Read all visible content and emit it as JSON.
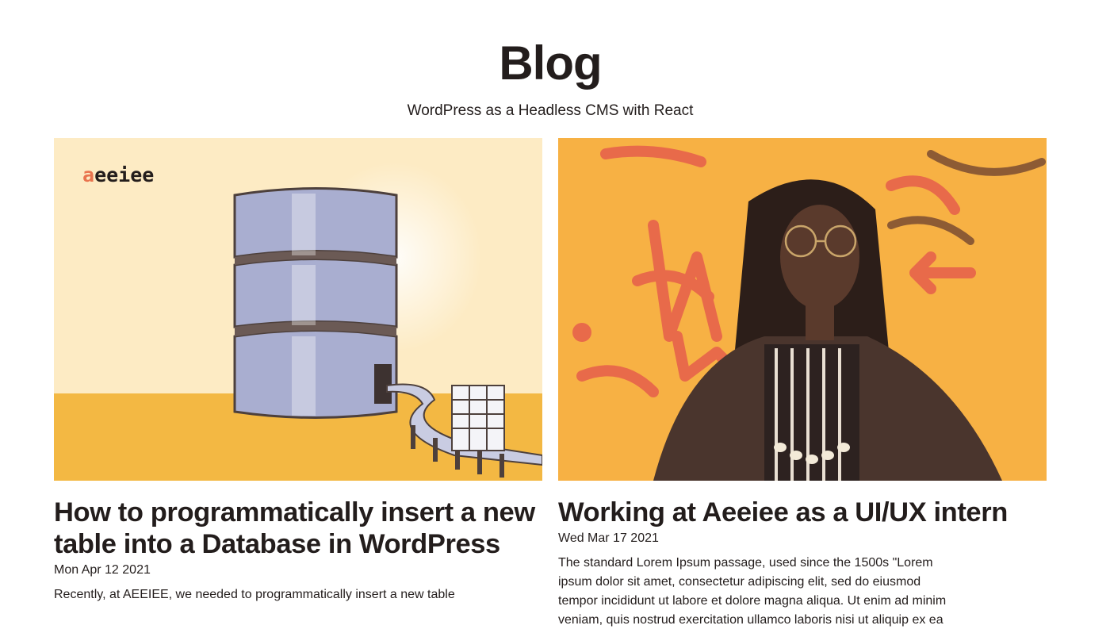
{
  "header": {
    "title": "Blog",
    "subtitle": "WordPress as a Headless CMS with React"
  },
  "posts": [
    {
      "image": {
        "logo_text": "aeeiee",
        "logo_accent": "#e9744e",
        "icon": "database-building-illustration"
      },
      "title": "How to programmatically insert a new table into a Database in WordPress",
      "date": "Mon Apr 12 2021",
      "excerpt": "Recently, at AEEIEE, we needed to programmatically insert a new table"
    },
    {
      "image": {
        "icon": "portrait-graffiti-photo"
      },
      "title": "Working at Aeeiee as a UI/UX intern",
      "date": "Wed Mar 17 2021",
      "excerpt": "The standard Lorem Ipsum passage, used since the 1500s \"Lorem ipsum dolor sit amet, consectetur adipiscing elit, sed do eiusmod tempor incididunt ut labore et dolore magna aliqua. Ut enim ad minim veniam, quis nostrud exercitation ullamco laboris nisi ut aliquip ex ea"
    }
  ],
  "colors": {
    "text": "#231d1c",
    "illustration_bg": "#fdebc4",
    "illustration_floor": "#f3b843",
    "graffiti_bg": "#f6a93b",
    "graffiti_paint": "#e86a4a"
  }
}
